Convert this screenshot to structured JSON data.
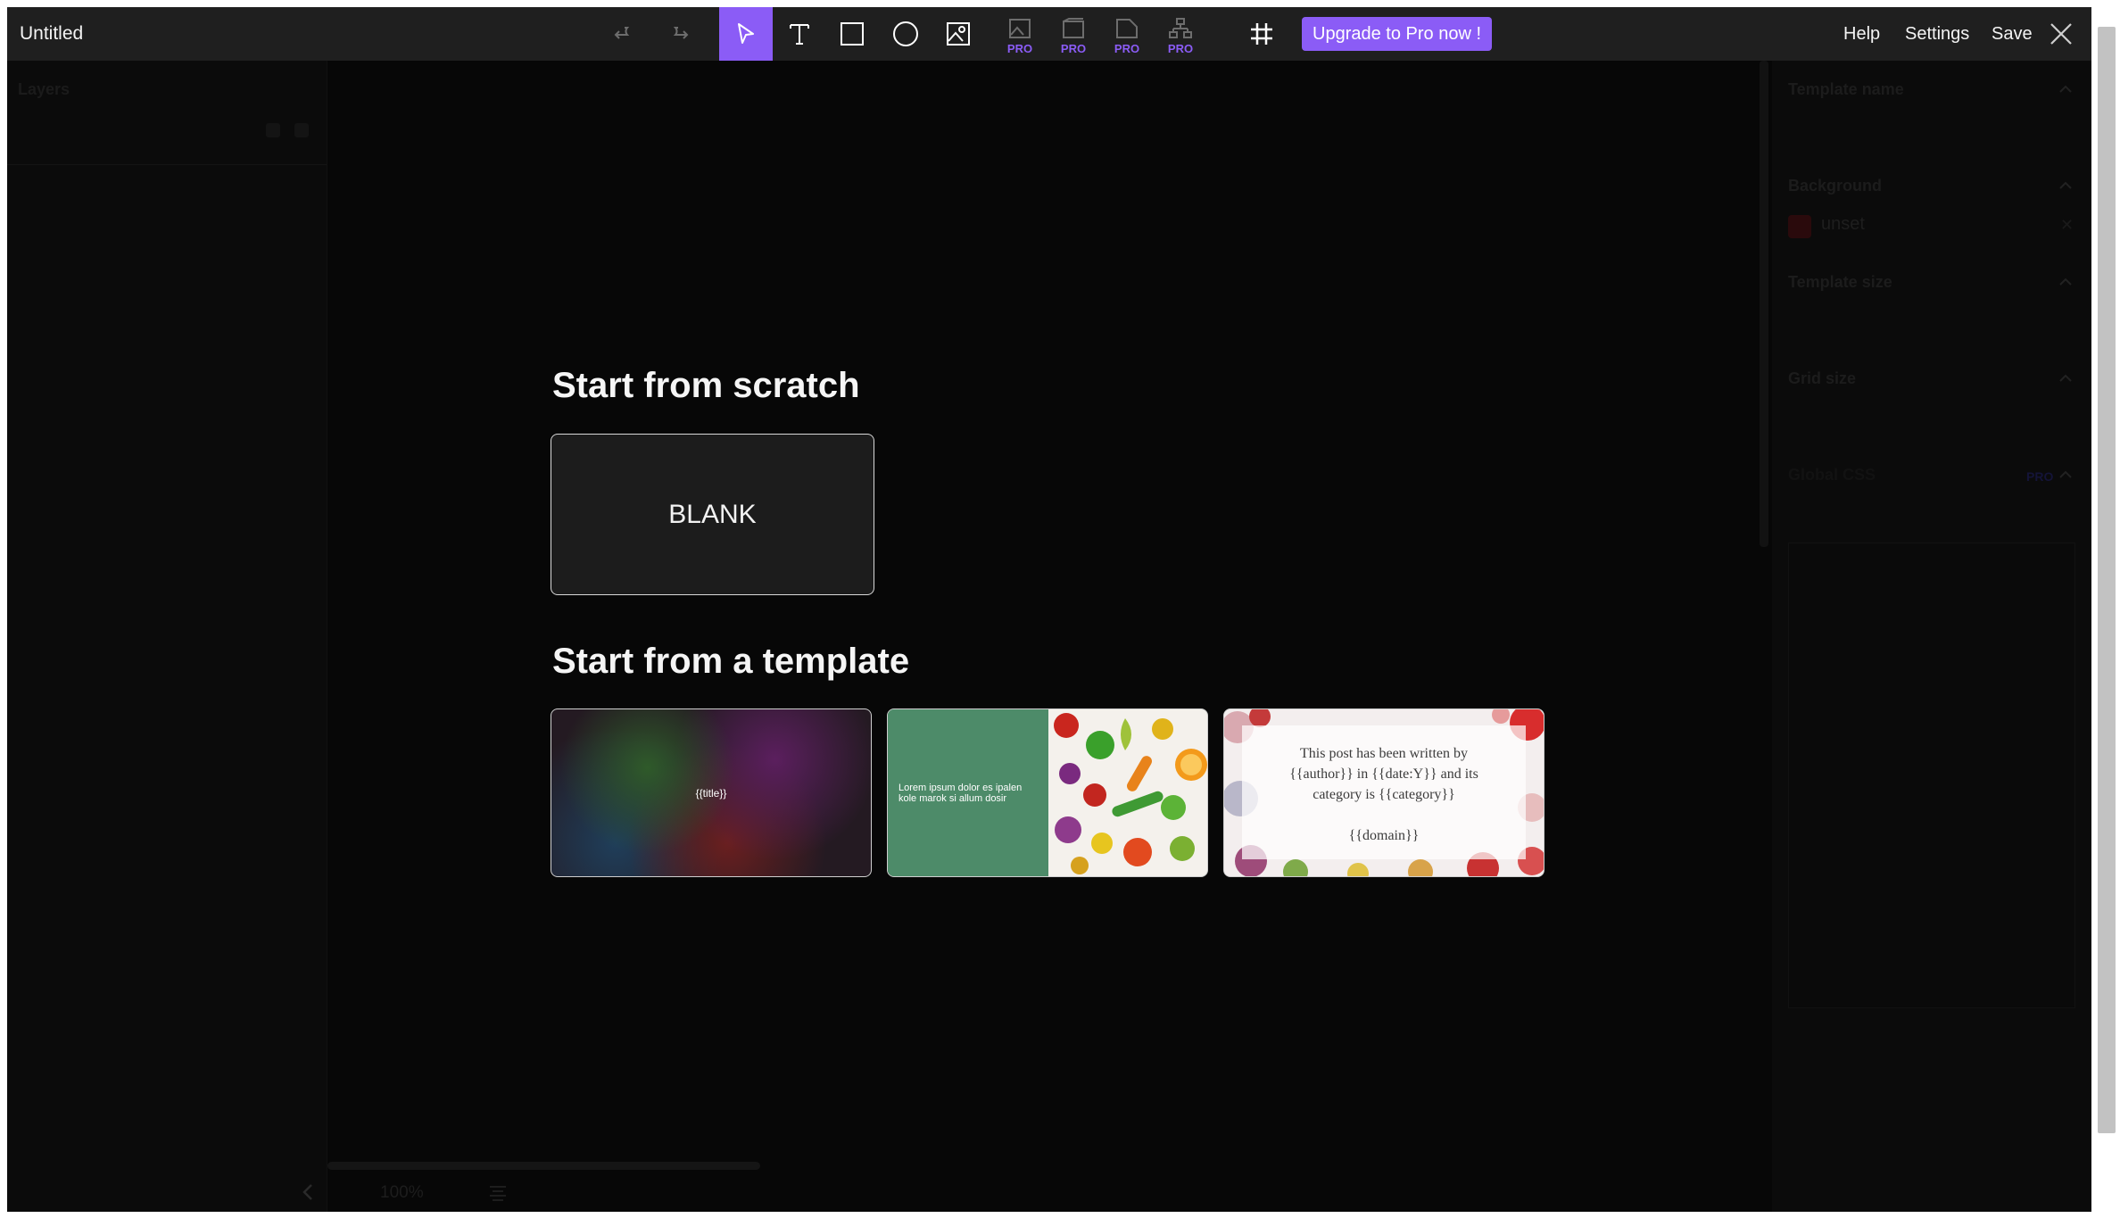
{
  "app": {
    "title": "Untitled"
  },
  "toolbar": {
    "tools": [
      {
        "name": "undo",
        "icon": "undo-icon"
      },
      {
        "name": "redo",
        "icon": "redo-icon"
      },
      {
        "name": "select",
        "icon": "cursor-icon"
      },
      {
        "name": "text",
        "icon": "text-icon"
      },
      {
        "name": "rectangle",
        "icon": "square-icon"
      },
      {
        "name": "ellipse",
        "icon": "circle-icon"
      },
      {
        "name": "image",
        "icon": "image-icon"
      }
    ],
    "pro_label": "PRO",
    "pro_tools": [
      "dynamic-image-icon",
      "shape-pro-icon",
      "qr-pro-icon",
      "chart-pro-icon"
    ],
    "grid_icon": "grid-icon",
    "upgrade_label": "Upgrade to Pro now !",
    "help": "Help",
    "settings": "Settings",
    "save": "Save",
    "accent": "#8b5cf6"
  },
  "layers": {
    "title": "Layers"
  },
  "properties": {
    "template_name": "Template name",
    "background": "Background",
    "background_value": "unset",
    "template_size": "Template size",
    "grid_size": "Grid size",
    "css_label": "Global CSS",
    "pro": "PRO"
  },
  "main": {
    "scratch_title": "Start from scratch",
    "blank_label": "BLANK",
    "template_title": "Start from a template",
    "templates": [
      {
        "text": "{{title}}"
      },
      {
        "text": "Lorem ipsum dolor es ipalen kole marok si allum dosir"
      },
      {
        "text": "This post has been written by\n{{author}} in {{date:Y}} and its\ncategory is {{category}}\n\n{{domain}}"
      }
    ]
  },
  "zoom": {
    "level": "100%"
  }
}
